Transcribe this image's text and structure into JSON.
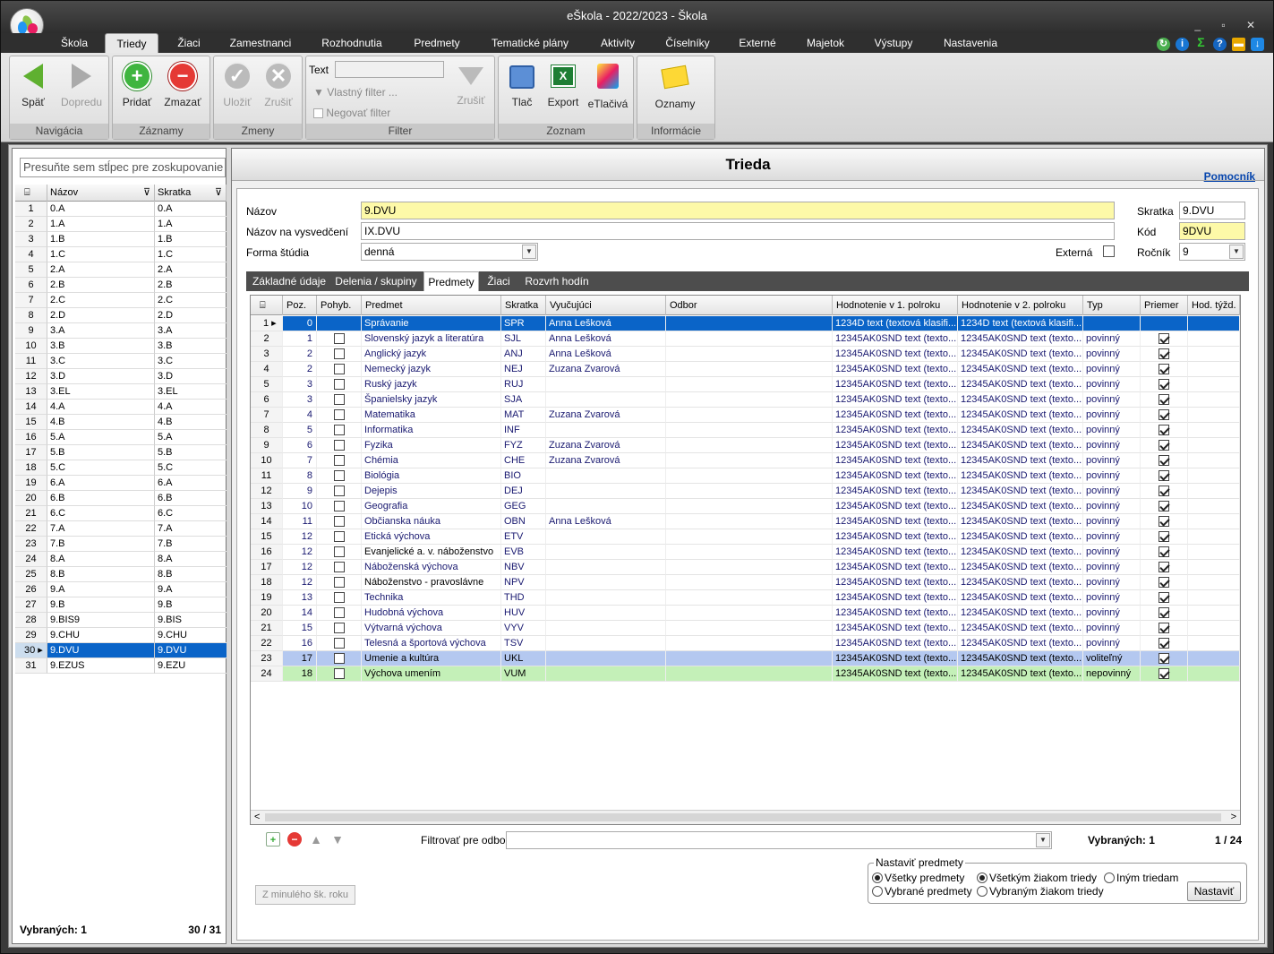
{
  "window": {
    "title": "eŠkola - 2022/2023 - Škola"
  },
  "menu": {
    "tabs": [
      "Škola",
      "Triedy",
      "Žiaci",
      "Zamestnanci",
      "Rozhodnutia",
      "Predmety",
      "Tematické plány",
      "Aktivity",
      "Číselníky",
      "Externé",
      "Majetok",
      "Výstupy",
      "Nastavenia"
    ],
    "active": "Triedy"
  },
  "ribbon": {
    "navigacia": {
      "label": "Navigácia",
      "back": "Späť",
      "forward": "Dopredu"
    },
    "zaznamy": {
      "label": "Záznamy",
      "add": "Pridať",
      "delete": "Zmazať"
    },
    "zmeny": {
      "label": "Zmeny",
      "save": "Uložiť",
      "cancel": "Zrušiť"
    },
    "filter": {
      "label": "Filter",
      "text": "Text",
      "custom": "Vlastný filter ...",
      "negate": "Negovať filter",
      "clear": "Zrušiť"
    },
    "zoznam": {
      "label": "Zoznam",
      "print": "Tlač",
      "export": "Export",
      "eprint": "eTlačivá"
    },
    "informacie": {
      "label": "Informácie",
      "notices": "Oznamy"
    }
  },
  "left": {
    "group_placeholder": "Presuňte sem stĺpec pre zoskupovanie",
    "headers": {
      "name": "Názov",
      "short": "Skratka"
    },
    "rows": [
      [
        "1",
        "0.A",
        "0.A"
      ],
      [
        "2",
        "1.A",
        "1.A"
      ],
      [
        "3",
        "1.B",
        "1.B"
      ],
      [
        "4",
        "1.C",
        "1.C"
      ],
      [
        "5",
        "2.A",
        "2.A"
      ],
      [
        "6",
        "2.B",
        "2.B"
      ],
      [
        "7",
        "2.C",
        "2.C"
      ],
      [
        "8",
        "2.D",
        "2.D"
      ],
      [
        "9",
        "3.A",
        "3.A"
      ],
      [
        "10",
        "3.B",
        "3.B"
      ],
      [
        "11",
        "3.C",
        "3.C"
      ],
      [
        "12",
        "3.D",
        "3.D"
      ],
      [
        "13",
        "3.EL",
        "3.EL"
      ],
      [
        "14",
        "4.A",
        "4.A"
      ],
      [
        "15",
        "4.B",
        "4.B"
      ],
      [
        "16",
        "5.A",
        "5.A"
      ],
      [
        "17",
        "5.B",
        "5.B"
      ],
      [
        "18",
        "5.C",
        "5.C"
      ],
      [
        "19",
        "6.A",
        "6.A"
      ],
      [
        "20",
        "6.B",
        "6.B"
      ],
      [
        "21",
        "6.C",
        "6.C"
      ],
      [
        "22",
        "7.A",
        "7.A"
      ],
      [
        "23",
        "7.B",
        "7.B"
      ],
      [
        "24",
        "8.A",
        "8.A"
      ],
      [
        "25",
        "8.B",
        "8.B"
      ],
      [
        "26",
        "9.A",
        "9.A"
      ],
      [
        "27",
        "9.B",
        "9.B"
      ],
      [
        "28",
        "9.BIS9",
        "9.BIS"
      ],
      [
        "29",
        "9.CHU",
        "9.CHU"
      ],
      [
        "30",
        "9.DVU",
        "9.DVU"
      ],
      [
        "31",
        "9.EZUS",
        "9.EZU"
      ]
    ],
    "selected_index": 29,
    "footer_selected": "Vybraných: 1",
    "footer_count": "30 / 31"
  },
  "right": {
    "title": "Trieda",
    "help": "Pomocník",
    "fields": {
      "nazov_label": "Názov",
      "nazov": "9.DVU",
      "vysvedcenie_label": "Názov na vysvedčení",
      "vysvedcenie": "IX.DVU",
      "forma_label": "Forma štúdia",
      "forma": "denná",
      "skratka_label": "Skratka",
      "skratka": "9.DVU",
      "kod_label": "Kód",
      "kod": "9DVU",
      "externe_label": "Externá",
      "rocnik_label": "Ročník",
      "rocnik": "9"
    },
    "tabs": [
      "Základné údaje",
      "Delenia / skupiny",
      "Predmety",
      "Žiaci",
      "Rozvrh hodín"
    ],
    "active_tab": "Predmety",
    "grid": {
      "headers": [
        "Poz.",
        "Pohyb.",
        "Predmet",
        "Skratka",
        "Vyučujúci",
        "Odbor",
        "Hodnotenie v 1. polroku",
        "Hodnotenie v 2. polroku",
        "Typ",
        "Priemer",
        "Hod. týžd."
      ],
      "rows": [
        {
          "n": "1",
          "poz": "0",
          "pohyb": false,
          "predmet": "Správanie",
          "skr": "SPR",
          "vyuc": "Anna Lešková",
          "h1": "1234D text (textová klasifi...",
          "h2": "1234D text (textová klasifi...",
          "typ": "",
          "priemer": false,
          "style": "sel"
        },
        {
          "n": "2",
          "poz": "1",
          "pohyb": false,
          "predmet": "Slovenský jazyk a literatúra",
          "skr": "SJL",
          "vyuc": "Anna Lešková",
          "h1": "12345AK0SND text (texto...",
          "h2": "12345AK0SND text (texto...",
          "typ": "povinný",
          "priemer": true
        },
        {
          "n": "3",
          "poz": "2",
          "pohyb": false,
          "predmet": "Anglický jazyk",
          "skr": "ANJ",
          "vyuc": "Anna Lešková",
          "h1": "12345AK0SND text (texto...",
          "h2": "12345AK0SND text (texto...",
          "typ": "povinný",
          "priemer": true
        },
        {
          "n": "4",
          "poz": "2",
          "pohyb": false,
          "predmet": "Nemecký jazyk",
          "skr": "NEJ",
          "vyuc": "Zuzana Zvarová",
          "h1": "12345AK0SND text (texto...",
          "h2": "12345AK0SND text (texto...",
          "typ": "povinný",
          "priemer": true
        },
        {
          "n": "5",
          "poz": "3",
          "pohyb": false,
          "predmet": "Ruský jazyk",
          "skr": "RUJ",
          "vyuc": "",
          "h1": "12345AK0SND text (texto...",
          "h2": "12345AK0SND text (texto...",
          "typ": "povinný",
          "priemer": true
        },
        {
          "n": "6",
          "poz": "3",
          "pohyb": false,
          "predmet": "Španielsky jazyk",
          "skr": "SJA",
          "vyuc": "",
          "h1": "12345AK0SND text (texto...",
          "h2": "12345AK0SND text (texto...",
          "typ": "povinný",
          "priemer": true
        },
        {
          "n": "7",
          "poz": "4",
          "pohyb": false,
          "predmet": "Matematika",
          "skr": "MAT",
          "vyuc": "Zuzana Zvarová",
          "h1": "12345AK0SND text (texto...",
          "h2": "12345AK0SND text (texto...",
          "typ": "povinný",
          "priemer": true
        },
        {
          "n": "8",
          "poz": "5",
          "pohyb": false,
          "predmet": "Informatika",
          "skr": "INF",
          "vyuc": "",
          "h1": "12345AK0SND text (texto...",
          "h2": "12345AK0SND text (texto...",
          "typ": "povinný",
          "priemer": true
        },
        {
          "n": "9",
          "poz": "6",
          "pohyb": false,
          "predmet": "Fyzika",
          "skr": "FYZ",
          "vyuc": "Zuzana Zvarová",
          "h1": "12345AK0SND text (texto...",
          "h2": "12345AK0SND text (texto...",
          "typ": "povinný",
          "priemer": true
        },
        {
          "n": "10",
          "poz": "7",
          "pohyb": false,
          "predmet": "Chémia",
          "skr": "CHE",
          "vyuc": "Zuzana Zvarová",
          "h1": "12345AK0SND text (texto...",
          "h2": "12345AK0SND text (texto...",
          "typ": "povinný",
          "priemer": true
        },
        {
          "n": "11",
          "poz": "8",
          "pohyb": false,
          "predmet": "Biológia",
          "skr": "BIO",
          "vyuc": "",
          "h1": "12345AK0SND text (texto...",
          "h2": "12345AK0SND text (texto...",
          "typ": "povinný",
          "priemer": true
        },
        {
          "n": "12",
          "poz": "9",
          "pohyb": false,
          "predmet": "Dejepis",
          "skr": "DEJ",
          "vyuc": "",
          "h1": "12345AK0SND text (texto...",
          "h2": "12345AK0SND text (texto...",
          "typ": "povinný",
          "priemer": true
        },
        {
          "n": "13",
          "poz": "10",
          "pohyb": false,
          "predmet": "Geografia",
          "skr": "GEG",
          "vyuc": "",
          "h1": "12345AK0SND text (texto...",
          "h2": "12345AK0SND text (texto...",
          "typ": "povinný",
          "priemer": true
        },
        {
          "n": "14",
          "poz": "11",
          "pohyb": false,
          "predmet": "Občianska náuka",
          "skr": "OBN",
          "vyuc": "Anna Lešková",
          "h1": "12345AK0SND text (texto...",
          "h2": "12345AK0SND text (texto...",
          "typ": "povinný",
          "priemer": true
        },
        {
          "n": "15",
          "poz": "12",
          "pohyb": false,
          "predmet": "Etická výchova",
          "skr": "ETV",
          "vyuc": "",
          "h1": "12345AK0SND text (texto...",
          "h2": "12345AK0SND text (texto...",
          "typ": "povinný",
          "priemer": true
        },
        {
          "n": "16",
          "poz": "12",
          "pohyb": false,
          "predmet": "Evanjelické a. v. náboženstvo",
          "skr": "EVB",
          "vyuc": "",
          "h1": "12345AK0SND text (texto...",
          "h2": "12345AK0SND text (texto...",
          "typ": "povinný",
          "priemer": true,
          "black": true
        },
        {
          "n": "17",
          "poz": "12",
          "pohyb": false,
          "predmet": "Náboženská výchova",
          "skr": "NBV",
          "vyuc": "",
          "h1": "12345AK0SND text (texto...",
          "h2": "12345AK0SND text (texto...",
          "typ": "povinný",
          "priemer": true
        },
        {
          "n": "18",
          "poz": "12",
          "pohyb": false,
          "predmet": "Náboženstvo - pravoslávne",
          "skr": "NPV",
          "vyuc": "",
          "h1": "12345AK0SND text (texto...",
          "h2": "12345AK0SND text (texto...",
          "typ": "povinný",
          "priemer": true,
          "black": true
        },
        {
          "n": "19",
          "poz": "13",
          "pohyb": false,
          "predmet": "Technika",
          "skr": "THD",
          "vyuc": "",
          "h1": "12345AK0SND text (texto...",
          "h2": "12345AK0SND text (texto...",
          "typ": "povinný",
          "priemer": true
        },
        {
          "n": "20",
          "poz": "14",
          "pohyb": false,
          "predmet": "Hudobná výchova",
          "skr": "HUV",
          "vyuc": "",
          "h1": "12345AK0SND text (texto...",
          "h2": "12345AK0SND text (texto...",
          "typ": "povinný",
          "priemer": true
        },
        {
          "n": "21",
          "poz": "15",
          "pohyb": false,
          "predmet": "Výtvarná výchova",
          "skr": "VYV",
          "vyuc": "",
          "h1": "12345AK0SND text (texto...",
          "h2": "12345AK0SND text (texto...",
          "typ": "povinný",
          "priemer": true
        },
        {
          "n": "22",
          "poz": "16",
          "pohyb": false,
          "predmet": "Telesná a športová výchova",
          "skr": "TSV",
          "vyuc": "",
          "h1": "12345AK0SND text (texto...",
          "h2": "12345AK0SND text (texto...",
          "typ": "povinný",
          "priemer": true
        },
        {
          "n": "23",
          "poz": "17",
          "pohyb": false,
          "predmet": "Umenie a kultúra",
          "skr": "UKL",
          "vyuc": "",
          "h1": "12345AK0SND text (texto...",
          "h2": "12345AK0SND text (texto...",
          "typ": "voliteľný",
          "priemer": true,
          "style": "blue"
        },
        {
          "n": "24",
          "poz": "18",
          "pohyb": false,
          "predmet": "Výchova umením",
          "skr": "VUM",
          "vyuc": "",
          "h1": "12345AK0SND text (texto...",
          "h2": "12345AK0SND text (texto...",
          "typ": "nepovinný",
          "priemer": true,
          "style": "green"
        }
      ]
    },
    "filter_odbor_label": "Filtrovať pre odbor",
    "footer_selected": "Vybraných: 1",
    "footer_count": "1 / 24",
    "prev_year_button": "Z minulého šk. roku",
    "nastavit": {
      "legend": "Nastaviť predmety",
      "all_subjects": "Všetky predmety",
      "selected_subjects": "Vybrané predmety",
      "all_students": "Všetkým žiakom triedy",
      "selected_students": "Vybraným žiakom triedy",
      "other_classes": "Iným triedam",
      "button": "Nastaviť"
    }
  },
  "colors": {
    "selection": "#0a64c8",
    "field_yellow": "#fdf9a8",
    "row_blue": "#b4c8f0",
    "row_green": "#c4f0b8",
    "text_navy": "#191970"
  }
}
